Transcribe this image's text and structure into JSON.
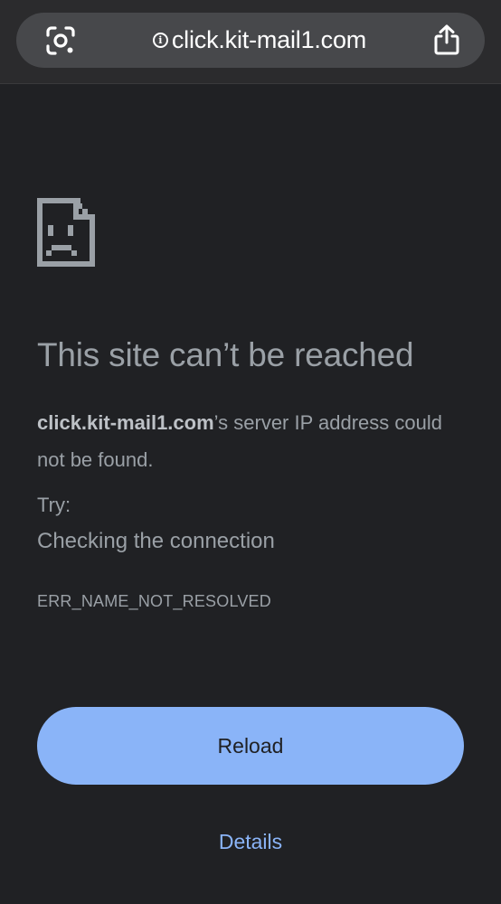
{
  "address_bar": {
    "url": "click.kit-mail1.com",
    "lens_icon": "google-lens-icon",
    "info_icon": "info-circle-icon",
    "share_icon": "share-icon",
    "info_glyph": "i"
  },
  "error": {
    "icon": "sad-page-icon",
    "title": "This site can’t be reached",
    "host": "click.kit-mail1.com",
    "message_rest": "’s server IP address could not be found.",
    "try_label": "Try:",
    "suggestion": "Checking the connection",
    "code": "ERR_NAME_NOT_RESOLVED"
  },
  "actions": {
    "reload_label": "Reload",
    "details_label": "Details"
  },
  "colors": {
    "page_background": "#202124",
    "chrome_background": "#2b2b2d",
    "url_pill": "#47484b",
    "text_secondary": "#9aa0a6",
    "accent_blue": "#8ab4f8"
  }
}
